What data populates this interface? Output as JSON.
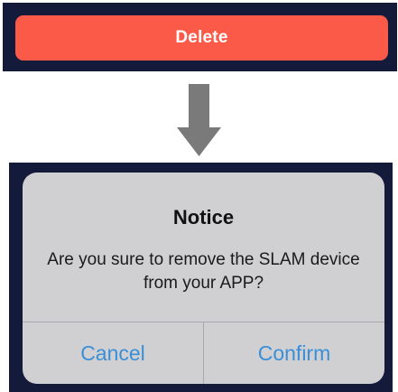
{
  "top": {
    "delete_label": "Delete"
  },
  "dialog": {
    "title": "Notice",
    "message": "Are you sure to remove the SLAM device from your APP?",
    "cancel_label": "Cancel",
    "confirm_label": "Confirm"
  },
  "icons": {
    "flow_arrow": "arrow-down-icon"
  },
  "colors": {
    "panel_background": "#141a3a",
    "delete_button": "#fc5a48",
    "dialog_background": "#d0d0d2",
    "action_text": "#3a8fd6",
    "arrow": "#7a7a7a"
  }
}
